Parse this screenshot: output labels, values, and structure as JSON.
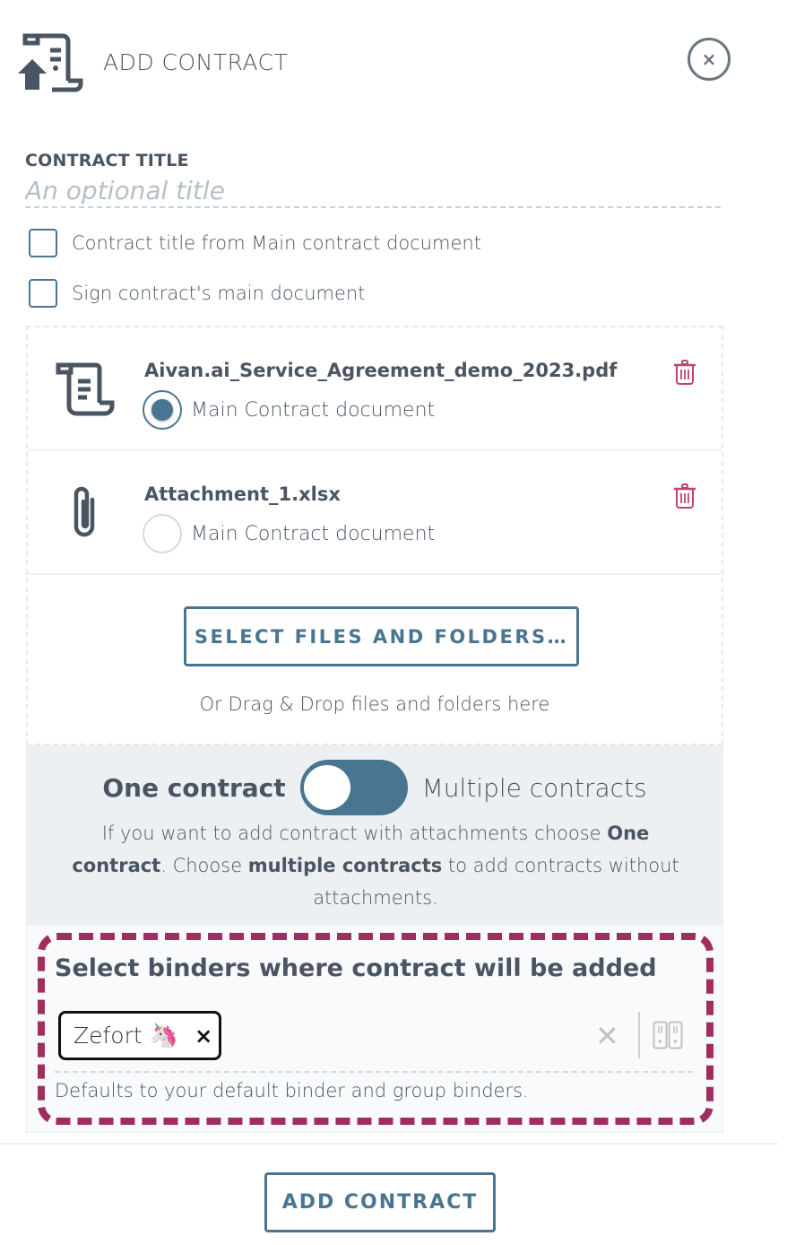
{
  "header": {
    "title": "ADD CONTRACT",
    "icon": "contract-upload-icon",
    "close_icon": "close-icon",
    "close_glyph": "×"
  },
  "contract_title": {
    "label": "CONTRACT TITLE",
    "value": "",
    "placeholder": "An optional title"
  },
  "options": {
    "title_from_main": {
      "label": "Contract title from Main contract document",
      "checked": false
    },
    "sign_main": {
      "label": "Sign contract's main document",
      "checked": false
    }
  },
  "files": [
    {
      "name": "Aivan.ai_Service_Agreement_demo_2023.pdf",
      "icon": "scroll-document-icon",
      "radio_label": "Main Contract document",
      "is_main": true
    },
    {
      "name": "Attachment_1.xlsx",
      "icon": "paperclip-icon",
      "radio_label": "Main Contract document",
      "is_main": false
    }
  ],
  "upload": {
    "button_label": "SELECT FILES AND FOLDERS…",
    "drop_text": "Or Drag & Drop files and folders here"
  },
  "mode": {
    "left_label": "One contract",
    "right_label": "Multiple contracts",
    "selected": "One contract",
    "desc_1": "If you want to add contract with attachments choose ",
    "desc_b1": "One contract",
    "desc_2": ". Choose ",
    "desc_b2": "multiple contracts",
    "desc_3": " to add contracts without attachments."
  },
  "binders": {
    "title": "Select binders where contract will be added",
    "selected": [
      {
        "label": "Zefort",
        "emoji": "🦄",
        "remove_glyph": "×"
      }
    ],
    "clear_glyph": "✕",
    "hint": "Defaults to your default binder and group binders.",
    "highlight_color": "#a02c62"
  },
  "footer": {
    "submit_label": "ADD CONTRACT"
  },
  "colors": {
    "accent": "#4a7590",
    "text": "#4a5563",
    "danger": "#c0436e"
  }
}
